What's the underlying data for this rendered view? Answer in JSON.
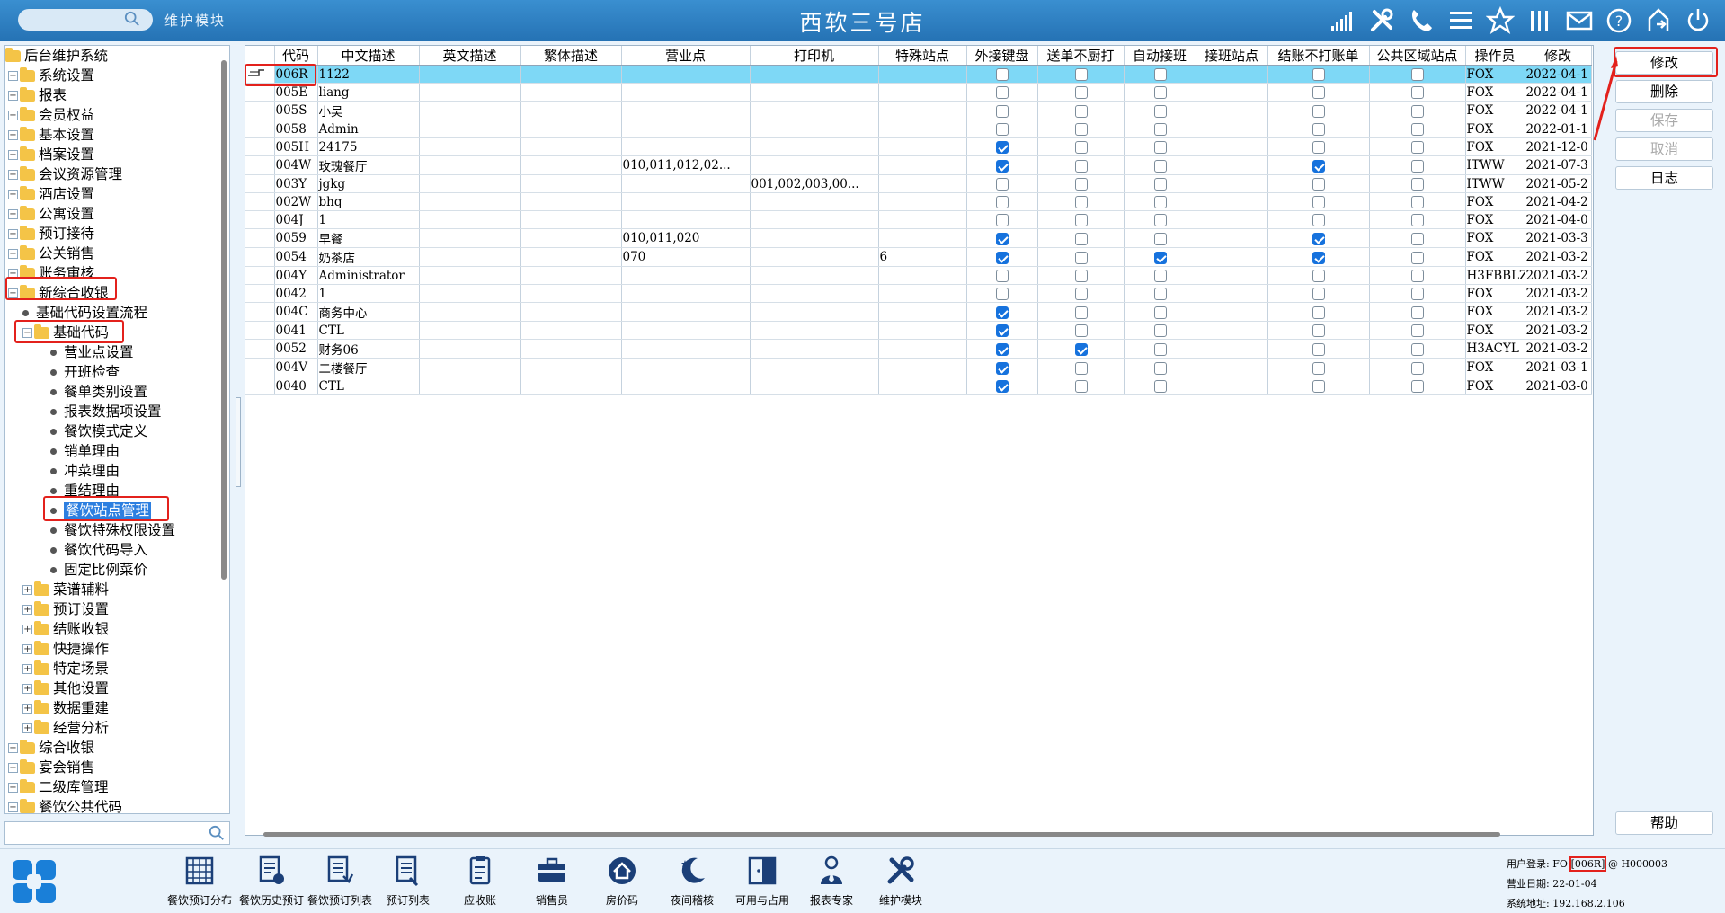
{
  "header": {
    "module_label": "维护模块",
    "title": "西软三号店"
  },
  "tree": {
    "rows": [
      {
        "label": "后台维护系统",
        "level": 0,
        "kind": "folder-root"
      },
      {
        "label": "系统设置",
        "level": 1,
        "kind": "folder",
        "pm": "+"
      },
      {
        "label": "报表",
        "level": 1,
        "kind": "folder",
        "pm": "+"
      },
      {
        "label": "会员权益",
        "level": 1,
        "kind": "folder",
        "pm": "+"
      },
      {
        "label": "基本设置",
        "level": 1,
        "kind": "folder",
        "pm": "+"
      },
      {
        "label": "档案设置",
        "level": 1,
        "kind": "folder",
        "pm": "+"
      },
      {
        "label": "会议资源管理",
        "level": 1,
        "kind": "folder",
        "pm": "+"
      },
      {
        "label": "酒店设置",
        "level": 1,
        "kind": "folder",
        "pm": "+"
      },
      {
        "label": "公寓设置",
        "level": 1,
        "kind": "folder",
        "pm": "+"
      },
      {
        "label": "预订接待",
        "level": 1,
        "kind": "folder",
        "pm": "+"
      },
      {
        "label": "公关销售",
        "level": 1,
        "kind": "folder",
        "pm": "+"
      },
      {
        "label": "账务审核",
        "level": 1,
        "kind": "folder",
        "pm": "+"
      },
      {
        "label": "新综合收银",
        "level": 1,
        "kind": "folder",
        "pm": "-"
      },
      {
        "label": "基础代码设置流程",
        "level": 2,
        "kind": "leaf"
      },
      {
        "label": "基础代码",
        "level": 2,
        "kind": "folder",
        "pm": "-"
      },
      {
        "label": "营业点设置",
        "level": 3,
        "kind": "leaf"
      },
      {
        "label": "开班检查",
        "level": 3,
        "kind": "leaf"
      },
      {
        "label": "餐单类别设置",
        "level": 3,
        "kind": "leaf"
      },
      {
        "label": "报表数据项设置",
        "level": 3,
        "kind": "leaf"
      },
      {
        "label": "餐饮模式定义",
        "level": 3,
        "kind": "leaf"
      },
      {
        "label": "销单理由",
        "level": 3,
        "kind": "leaf"
      },
      {
        "label": "冲菜理由",
        "level": 3,
        "kind": "leaf"
      },
      {
        "label": "重结理由",
        "level": 3,
        "kind": "leaf"
      },
      {
        "label": "餐饮站点管理",
        "level": 3,
        "kind": "leaf",
        "selected": true
      },
      {
        "label": "餐饮特殊权限设置",
        "level": 3,
        "kind": "leaf"
      },
      {
        "label": "餐饮代码导入",
        "level": 3,
        "kind": "leaf"
      },
      {
        "label": "固定比例菜价",
        "level": 3,
        "kind": "leaf"
      },
      {
        "label": "菜谱辅料",
        "level": 2,
        "kind": "folder",
        "pm": "+"
      },
      {
        "label": "预订设置",
        "level": 2,
        "kind": "folder",
        "pm": "+"
      },
      {
        "label": "结账收银",
        "level": 2,
        "kind": "folder",
        "pm": "+"
      },
      {
        "label": "快捷操作",
        "level": 2,
        "kind": "folder",
        "pm": "+"
      },
      {
        "label": "特定场景",
        "level": 2,
        "kind": "folder",
        "pm": "+"
      },
      {
        "label": "其他设置",
        "level": 2,
        "kind": "folder",
        "pm": "+"
      },
      {
        "label": "数据重建",
        "level": 2,
        "kind": "folder",
        "pm": "+"
      },
      {
        "label": "经营分析",
        "level": 2,
        "kind": "folder",
        "pm": "+"
      },
      {
        "label": "综合收银",
        "level": 1,
        "kind": "folder",
        "pm": "+"
      },
      {
        "label": "宴会销售",
        "level": 1,
        "kind": "folder",
        "pm": "+"
      },
      {
        "label": "二级库管理",
        "level": 1,
        "kind": "folder",
        "pm": "+"
      },
      {
        "label": "餐饮公共代码",
        "level": 1,
        "kind": "folder",
        "pm": "+"
      }
    ]
  },
  "grid": {
    "columns": [
      "代码",
      "中文描述",
      "英文描述",
      "繁体描述",
      "营业点",
      "打印机",
      "特殊站点",
      "外接键盘",
      "送单不厨打",
      "自动接班",
      "接班站点",
      "结账不打账单",
      "公共区域站点",
      "操作员",
      "修改"
    ],
    "rows": [
      {
        "code": "006R",
        "cn": "1122",
        "en": "",
        "tw": "",
        "outlet": "",
        "printer": "",
        "special": "",
        "kb": false,
        "nokitchen": false,
        "autoshift": false,
        "shiftstation": "",
        "nobill": false,
        "public": false,
        "operator": "FOX",
        "modified": "2022-04-1"
      },
      {
        "code": "005E",
        "cn": "liang",
        "en": "",
        "tw": "",
        "outlet": "",
        "printer": "",
        "special": "",
        "kb": false,
        "nokitchen": false,
        "autoshift": false,
        "shiftstation": "",
        "nobill": false,
        "public": false,
        "operator": "FOX",
        "modified": "2022-04-1"
      },
      {
        "code": "005S",
        "cn": "小吴",
        "en": "",
        "tw": "",
        "outlet": "",
        "printer": "",
        "special": "",
        "kb": false,
        "nokitchen": false,
        "autoshift": false,
        "shiftstation": "",
        "nobill": false,
        "public": false,
        "operator": "FOX",
        "modified": "2022-04-1"
      },
      {
        "code": "0058",
        "cn": "Admin",
        "en": "",
        "tw": "",
        "outlet": "",
        "printer": "",
        "special": "",
        "kb": false,
        "nokitchen": false,
        "autoshift": false,
        "shiftstation": "",
        "nobill": false,
        "public": false,
        "operator": "FOX",
        "modified": "2022-01-1"
      },
      {
        "code": "005H",
        "cn": "24175",
        "en": "",
        "tw": "",
        "outlet": "",
        "printer": "",
        "special": "",
        "kb": true,
        "nokitchen": false,
        "autoshift": false,
        "shiftstation": "",
        "nobill": false,
        "public": false,
        "operator": "FOX",
        "modified": "2021-12-0"
      },
      {
        "code": "004W",
        "cn": "玫瑰餐厅",
        "en": "",
        "tw": "",
        "outlet": "010,011,012,02...",
        "printer": "",
        "special": "",
        "kb": true,
        "nokitchen": false,
        "autoshift": false,
        "shiftstation": "",
        "nobill": true,
        "public": false,
        "operator": "ITWW",
        "modified": "2021-07-3"
      },
      {
        "code": "003Y",
        "cn": "jgkg",
        "en": "",
        "tw": "",
        "outlet": "",
        "printer": "001,002,003,00...",
        "special": "",
        "kb": false,
        "nokitchen": false,
        "autoshift": false,
        "shiftstation": "",
        "nobill": false,
        "public": false,
        "operator": "ITWW",
        "modified": "2021-05-2"
      },
      {
        "code": "002W",
        "cn": "bhq",
        "en": "",
        "tw": "",
        "outlet": "",
        "printer": "",
        "special": "",
        "kb": false,
        "nokitchen": false,
        "autoshift": false,
        "shiftstation": "",
        "nobill": false,
        "public": false,
        "operator": "FOX",
        "modified": "2021-04-2"
      },
      {
        "code": "004J",
        "cn": "1",
        "en": "",
        "tw": "",
        "outlet": "",
        "printer": "",
        "special": "",
        "kb": false,
        "nokitchen": false,
        "autoshift": false,
        "shiftstation": "",
        "nobill": false,
        "public": false,
        "operator": "FOX",
        "modified": "2021-04-0"
      },
      {
        "code": "0059",
        "cn": "早餐",
        "en": "",
        "tw": "",
        "outlet": "010,011,020",
        "printer": "",
        "special": "",
        "kb": true,
        "nokitchen": false,
        "autoshift": false,
        "shiftstation": "",
        "nobill": true,
        "public": false,
        "operator": "FOX",
        "modified": "2021-03-3"
      },
      {
        "code": "0054",
        "cn": "奶茶店",
        "en": "",
        "tw": "",
        "outlet": "070",
        "printer": "",
        "special": "6",
        "kb": true,
        "nokitchen": false,
        "autoshift": true,
        "shiftstation": "",
        "nobill": true,
        "public": false,
        "operator": "FOX",
        "modified": "2021-03-2"
      },
      {
        "code": "004Y",
        "cn": "Administrator",
        "en": "",
        "tw": "",
        "outlet": "",
        "printer": "",
        "special": "",
        "kb": false,
        "nokitchen": false,
        "autoshift": false,
        "shiftstation": "",
        "nobill": false,
        "public": false,
        "operator": "H3FBBLZ",
        "modified": "2021-03-2"
      },
      {
        "code": "0042",
        "cn": "1",
        "en": "",
        "tw": "",
        "outlet": "",
        "printer": "",
        "special": "",
        "kb": false,
        "nokitchen": false,
        "autoshift": false,
        "shiftstation": "",
        "nobill": false,
        "public": false,
        "operator": "FOX",
        "modified": "2021-03-2"
      },
      {
        "code": "004C",
        "cn": "商务中心",
        "en": "",
        "tw": "",
        "outlet": "",
        "printer": "",
        "special": "",
        "kb": true,
        "nokitchen": false,
        "autoshift": false,
        "shiftstation": "",
        "nobill": false,
        "public": false,
        "operator": "FOX",
        "modified": "2021-03-2"
      },
      {
        "code": "0041",
        "cn": "CTL",
        "en": "",
        "tw": "",
        "outlet": "",
        "printer": "",
        "special": "",
        "kb": true,
        "nokitchen": false,
        "autoshift": false,
        "shiftstation": "",
        "nobill": false,
        "public": false,
        "operator": "FOX",
        "modified": "2021-03-2"
      },
      {
        "code": "0052",
        "cn": "财务06",
        "en": "",
        "tw": "",
        "outlet": "",
        "printer": "",
        "special": "",
        "kb": true,
        "nokitchen": true,
        "autoshift": false,
        "shiftstation": "",
        "nobill": false,
        "public": false,
        "operator": "H3ACYL",
        "modified": "2021-03-2"
      },
      {
        "code": "004V",
        "cn": "二楼餐厅",
        "en": "",
        "tw": "",
        "outlet": "",
        "printer": "",
        "special": "",
        "kb": true,
        "nokitchen": false,
        "autoshift": false,
        "shiftstation": "",
        "nobill": false,
        "public": false,
        "operator": "FOX",
        "modified": "2021-03-1"
      },
      {
        "code": "0040",
        "cn": "CTL",
        "en": "",
        "tw": "",
        "outlet": "",
        "printer": "",
        "special": "",
        "kb": true,
        "nokitchen": false,
        "autoshift": false,
        "shiftstation": "",
        "nobill": false,
        "public": false,
        "operator": "FOX",
        "modified": "2021-03-0"
      }
    ]
  },
  "buttons": {
    "modify": "修改",
    "delete": "删除",
    "save": "保存",
    "cancel": "取消",
    "log": "日志",
    "help": "帮助"
  },
  "toolbar": [
    {
      "label": "餐饮预订分布",
      "icon": "grid-calendar-icon"
    },
    {
      "label": "餐饮历史预订",
      "icon": "history-doc-icon"
    },
    {
      "label": "餐饮预订列表",
      "icon": "list-doc-icon"
    },
    {
      "label": "预订列表",
      "icon": "booking-list-icon"
    },
    {
      "label": "应收账",
      "icon": "receivable-icon"
    },
    {
      "label": "销售员",
      "icon": "briefcase-icon"
    },
    {
      "label": "房价码",
      "icon": "house-icon"
    },
    {
      "label": "夜间稽核",
      "icon": "moon-icon"
    },
    {
      "label": "可用与占用",
      "icon": "door-icon"
    },
    {
      "label": "报表专家",
      "icon": "expert-icon"
    },
    {
      "label": "维护模块",
      "icon": "tools-icon"
    }
  ],
  "status": {
    "user_login_label": "用户登录:",
    "user_prefix": "FO:",
    "station_code": "[006R]",
    "user_suffix": "@ H000003",
    "business_date_label": "营业日期:",
    "business_date": "22-01-04",
    "system_address_label": "系统地址:",
    "system_address": "192.168.2.106"
  },
  "colors": {
    "header": "#2a78bb",
    "active_row": "#7ed8f6",
    "selection": "#2d7fe0",
    "checkbox_on": "#1672dd",
    "annotation": "#e3211c"
  }
}
